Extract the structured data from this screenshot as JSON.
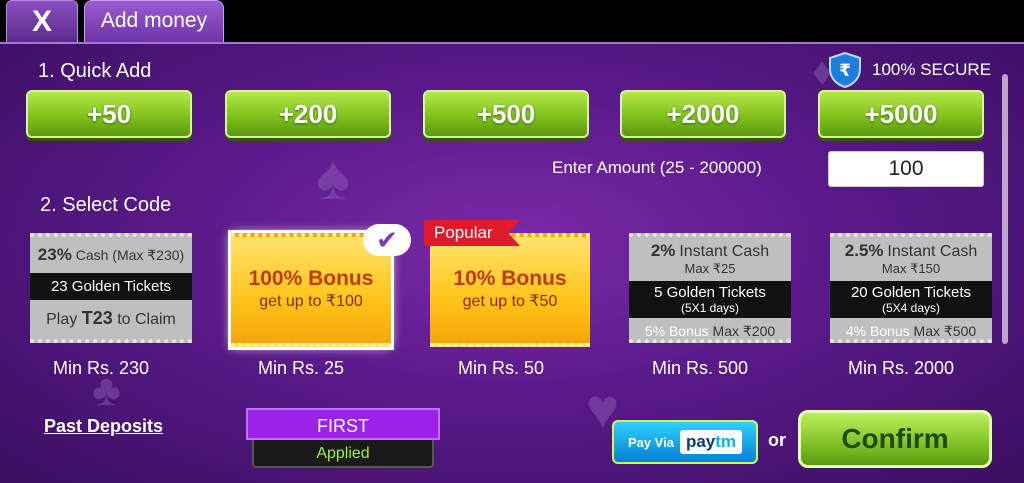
{
  "header": {
    "close_label": "X",
    "tab_label": "Add money"
  },
  "secure": {
    "label": "100% SECURE"
  },
  "quick_add": {
    "heading": "1. Quick Add",
    "buttons": [
      "+50",
      "+200",
      "+500",
      "+2000",
      "+5000"
    ]
  },
  "amount": {
    "label": "Enter Amount (25 - 200000)",
    "value": "100"
  },
  "select_code": {
    "heading": "2. Select Code",
    "popular_label": "Popular",
    "selected_mark": "✔",
    "codes": [
      {
        "pct": "23%",
        "line1": "Cash (Max ₹230)",
        "band": "23 Golden Tickets",
        "line3a": "Play",
        "line3b": "T23",
        "line3c": "to Claim",
        "min": "Min Rs. 230"
      },
      {
        "title": "100% Bonus",
        "sub": "get up to ₹100",
        "min": "Min Rs. 25"
      },
      {
        "title": "10% Bonus",
        "sub": "get up to ₹50",
        "min": "Min Rs. 50"
      },
      {
        "pct": "2%",
        "line1": "Instant Cash",
        "line2": "Max ₹25",
        "band": "5 Golden Tickets",
        "band_sub": "(5X1 days)",
        "foot_a": "5% Bonus",
        "foot_b": "Max ₹200",
        "min": "Min Rs. 500"
      },
      {
        "pct": "2.5%",
        "line1": "Instant Cash",
        "line2": "Max ₹150",
        "band": "20 Golden Tickets",
        "band_sub": "(5X4 days)",
        "foot_a": "4% Bonus",
        "foot_b": "Max ₹500",
        "min": "Min Rs. 2000"
      }
    ]
  },
  "footer": {
    "past_deposits": "Past Deposits",
    "applied_code": "FIRST",
    "applied_status": "Applied",
    "paytm_prefix": "Pay Via",
    "paytm_logo_a": "pay",
    "paytm_logo_b": "tm",
    "or_label": "or",
    "confirm_label": "Confirm"
  },
  "colors": {
    "panel": "#5a1a8a",
    "green_button": "#7fc21c",
    "gold_ticket": "#ffc419",
    "popular_red": "#e01a2a"
  }
}
